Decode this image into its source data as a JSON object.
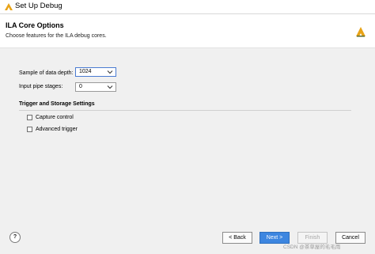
{
  "window": {
    "title": "Set Up Debug"
  },
  "header": {
    "title": "ILA Core Options",
    "subtitle": "Choose features for the ILA debug cores."
  },
  "form": {
    "sample_depth": {
      "label": "Sample of data depth:",
      "value": "1024"
    },
    "pipe_stages": {
      "label": "Input pipe stages:",
      "value": "0"
    }
  },
  "trigger_section": {
    "title": "Trigger and Storage Settings",
    "options": [
      {
        "label": "Capture control",
        "checked": false
      },
      {
        "label": "Advanced trigger",
        "checked": false
      }
    ]
  },
  "footer": {
    "help": "?",
    "back": "< Back",
    "next": "Next >",
    "finish": "Finish",
    "cancel": "Cancel"
  },
  "watermark": "CSDN @茶草屋的毛毛雨",
  "colors": {
    "accent": "#3d86e0",
    "logo": "#e8a317"
  }
}
